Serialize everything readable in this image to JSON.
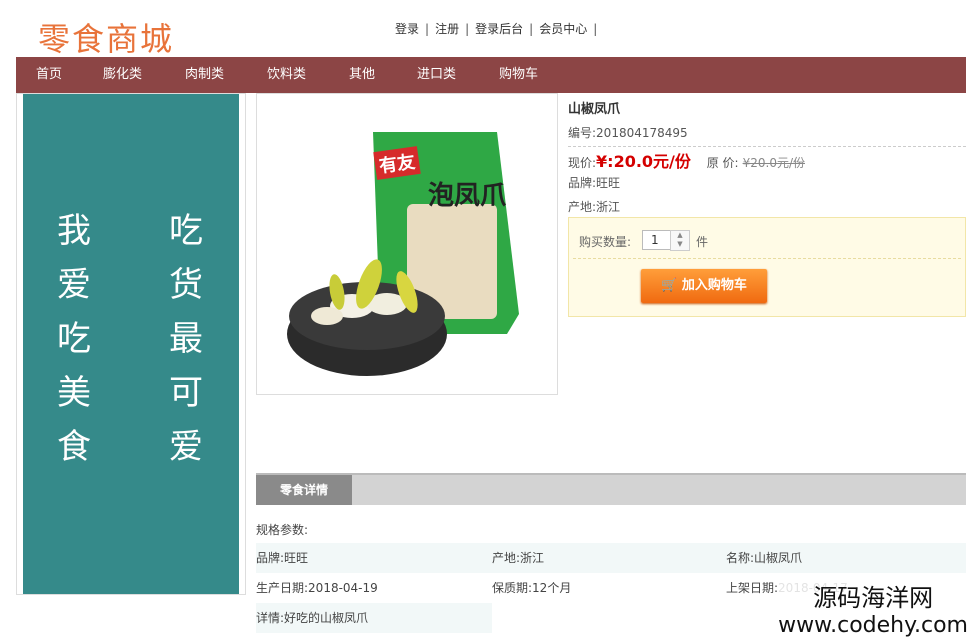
{
  "header": {
    "logo": "零食商城",
    "links": [
      "登录",
      "注册",
      "登录后台",
      "会员中心"
    ],
    "separator": "|"
  },
  "nav": {
    "items": [
      "首页",
      "膨化类",
      "肉制类",
      "饮料类",
      "其他",
      "进口类",
      "购物车"
    ],
    "bg_color": "#8c4545"
  },
  "poster": {
    "col1": [
      "我",
      "爱",
      "吃",
      "美",
      "食"
    ],
    "col2": [
      "吃",
      "货",
      "最",
      "可",
      "爱"
    ],
    "bg_color": "#358a8a"
  },
  "product": {
    "name": "山椒凤爪",
    "sku": "编号:201804178495",
    "price_label": "现价:",
    "price": "¥:20.0元/份",
    "orig_label": "原 价:",
    "orig_price": "¥20.0元/份",
    "brand": "品牌:旺旺",
    "origin": "产地:浙江",
    "package_brand": "有友",
    "package_name": "泡凤爪"
  },
  "buy": {
    "qty_label": "购买数量:",
    "qty_value": "1",
    "unit": "件",
    "add_cart_label": "加入购物车",
    "accent_color": "#f06a10"
  },
  "detail": {
    "tab_label": "零食详情",
    "params_label": "规格参数:",
    "row1": [
      "品牌:旺旺",
      "产地:浙江",
      "名称:山椒凤爪"
    ],
    "row2": [
      "生产日期:2018-04-19",
      "保质期:12个月",
      "上架日期:2018-04-17"
    ],
    "row3": [
      "详情:好吃的山椒凤爪"
    ]
  },
  "watermark": {
    "line1": "源码海洋网",
    "line2": "www.codehy.com"
  }
}
